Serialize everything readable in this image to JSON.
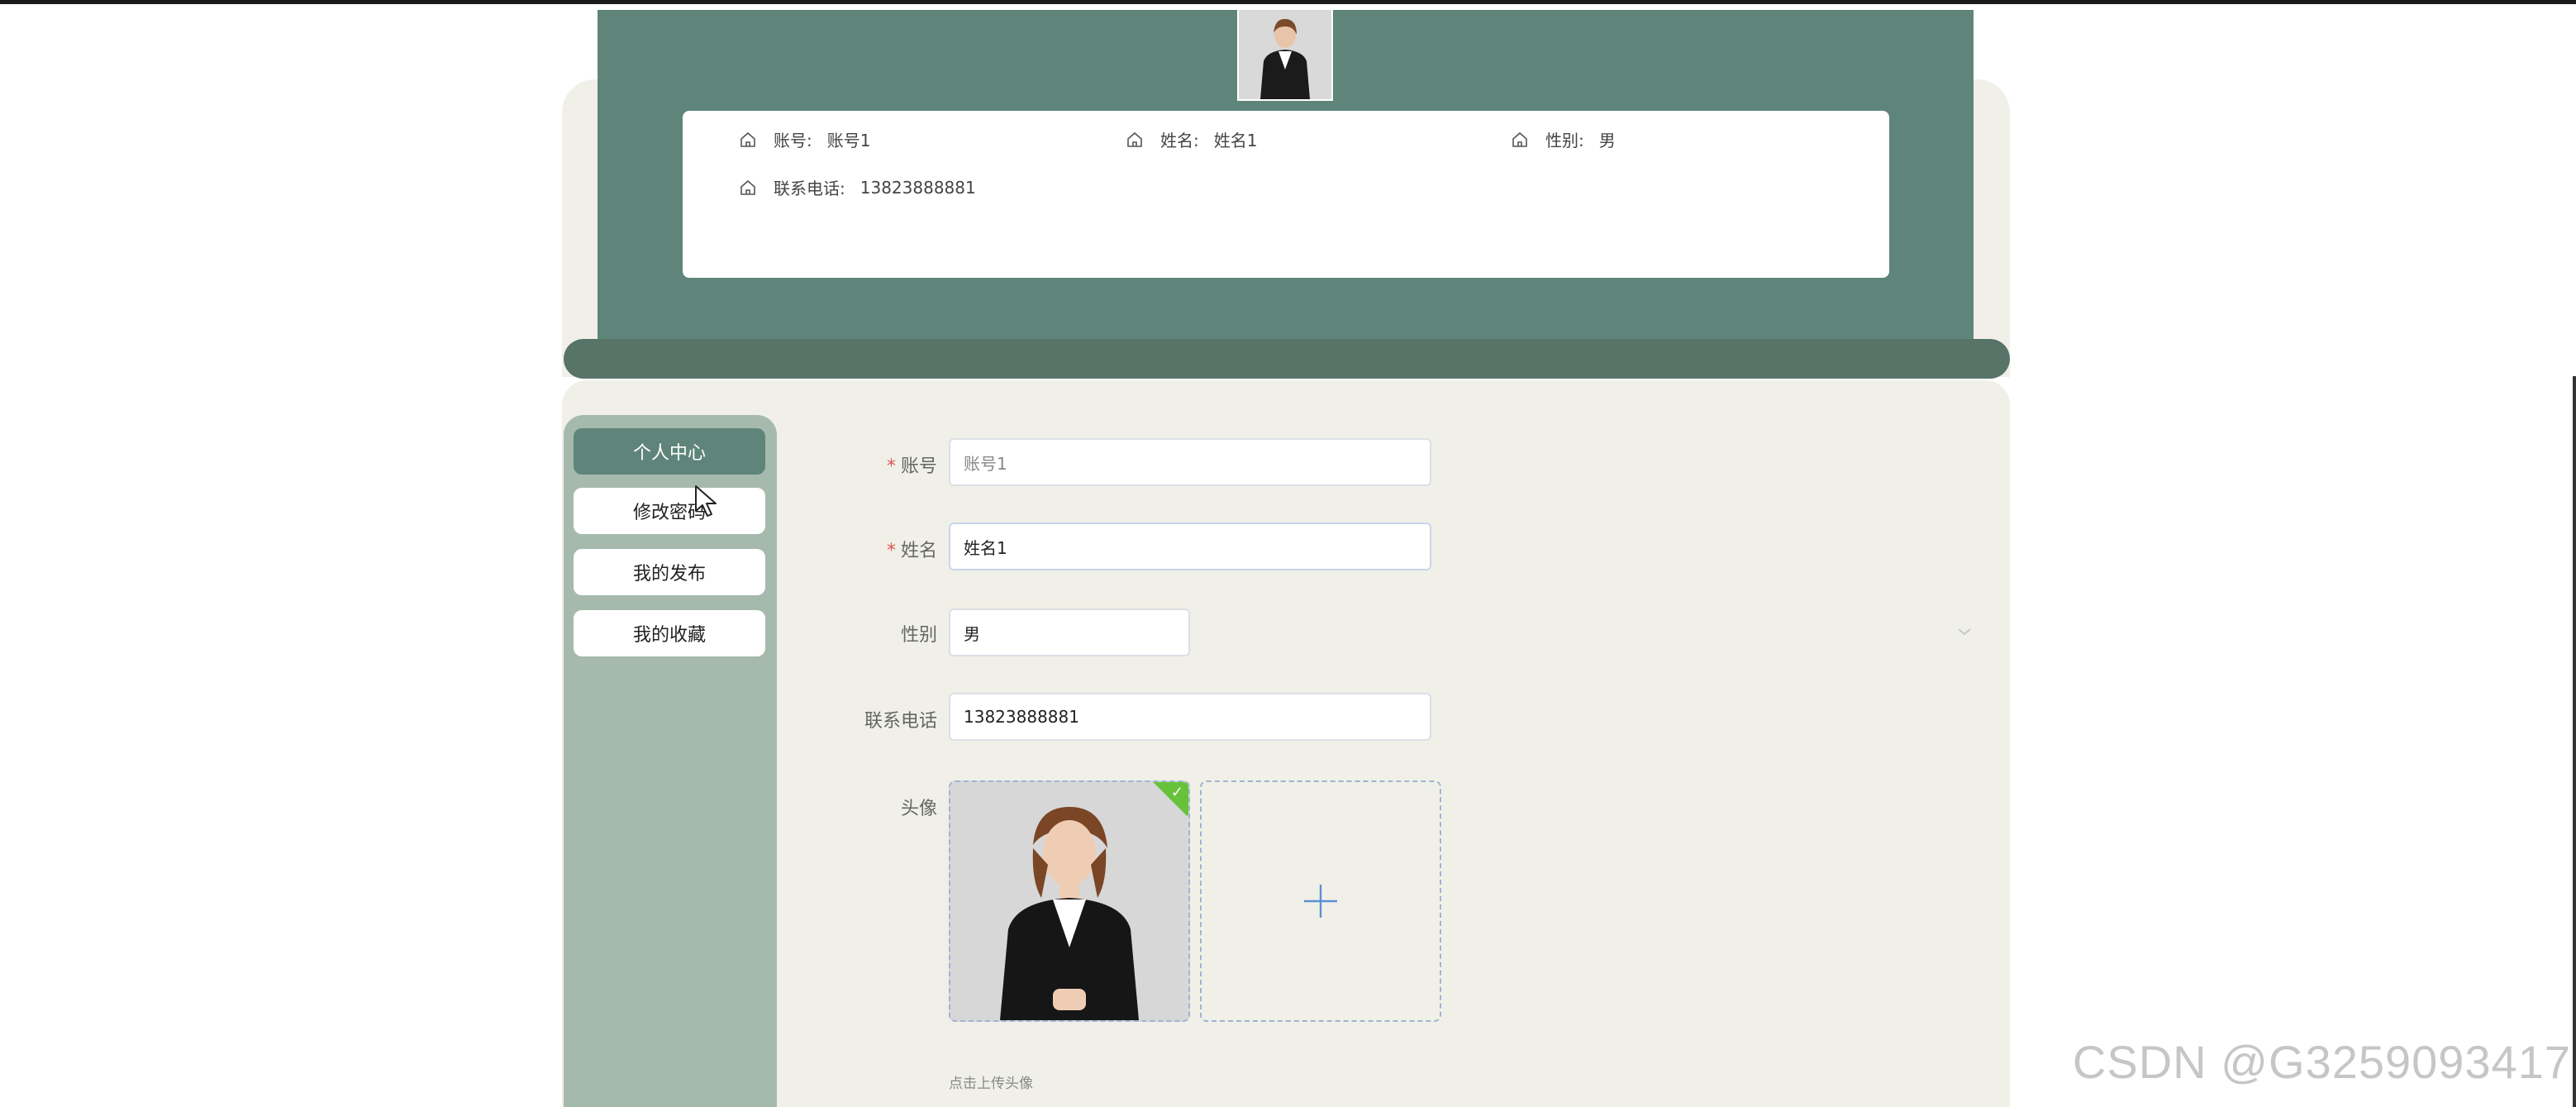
{
  "profile_card": {
    "account_label": "账号:",
    "account_value": "账号1",
    "name_label": "姓名:",
    "name_value": "姓名1",
    "gender_label": "性别:",
    "gender_value": "男",
    "phone_label": "联系电话:",
    "phone_value": "13823888881"
  },
  "sidebar": {
    "items": [
      {
        "label": "个人中心",
        "active": true
      },
      {
        "label": "修改密码"
      },
      {
        "label": "我的发布"
      },
      {
        "label": "我的收藏"
      }
    ]
  },
  "form": {
    "account": {
      "label": "账号",
      "value": "账号1"
    },
    "name": {
      "label": "姓名",
      "value": "姓名1"
    },
    "gender": {
      "label": "性别",
      "value": "男"
    },
    "phone": {
      "label": "联系电话",
      "value": "13823888881"
    },
    "avatar": {
      "label": "头像",
      "hint": "点击上传头像"
    }
  },
  "watermark": "CSDN @G3259093417",
  "icons": [
    "home-icon",
    "chevron-down-icon",
    "plus-icon",
    "check-icon",
    "cursor-icon"
  ],
  "colors": {
    "primary": "#5f857a",
    "bar": "#587469",
    "cream": "#f0f0e8",
    "sidebar": "#a6b9ad",
    "success": "#67c23a"
  }
}
